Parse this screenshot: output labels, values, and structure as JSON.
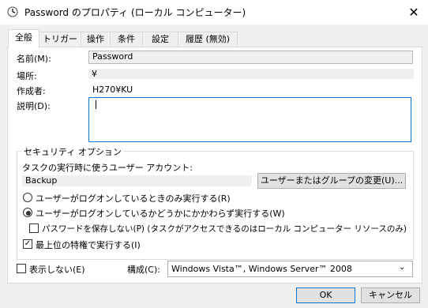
{
  "window": {
    "title": "Password のプロパティ (ローカル コンピューター)"
  },
  "tabs": [
    "全般",
    "トリガー",
    "操作",
    "条件",
    "設定",
    "履歴 (無効)"
  ],
  "general": {
    "name_label": "名前(M):",
    "name_value": "Password",
    "location_label": "場所:",
    "location_value": "¥",
    "author_label": "作成者:",
    "author_value": "H270¥KU",
    "description_label": "説明(D):"
  },
  "security": {
    "group_title": "セキュリティ オプション",
    "account_label": "タスクの実行時に使うユーザー アカウント:",
    "account_value": "Backup",
    "change_user_button": "ユーザーまたはグループの変更(U)...",
    "radio_logged_on": "ユーザーがログオンしているときのみ実行する(R)",
    "radio_whether": "ユーザーがログオンしているかどうかにかかわらず実行する(W)",
    "radio_selected": "whether",
    "no_store_password": "パスワードを保存しない(P) (タスクがアクセスできるのはローカル コンピューター リソースのみ)",
    "no_store_password_checked": false,
    "highest_privileges": "最上位の特権で実行する(I)",
    "highest_privileges_checked": true
  },
  "hidden_label": "表示しない(E)",
  "hidden_checked": false,
  "configure_label": "構成(C):",
  "configure_value": "Windows Vista™, Windows Server™ 2008",
  "buttons": {
    "ok": "OK",
    "cancel": "キャンセル"
  },
  "colors": {
    "accent": "#0078d7",
    "panel": "#ffffff",
    "background": "#f0f0f0"
  },
  "icons": {
    "title": "clock-icon",
    "close": "close-icon",
    "dropdown": "chevron-down-icon"
  }
}
